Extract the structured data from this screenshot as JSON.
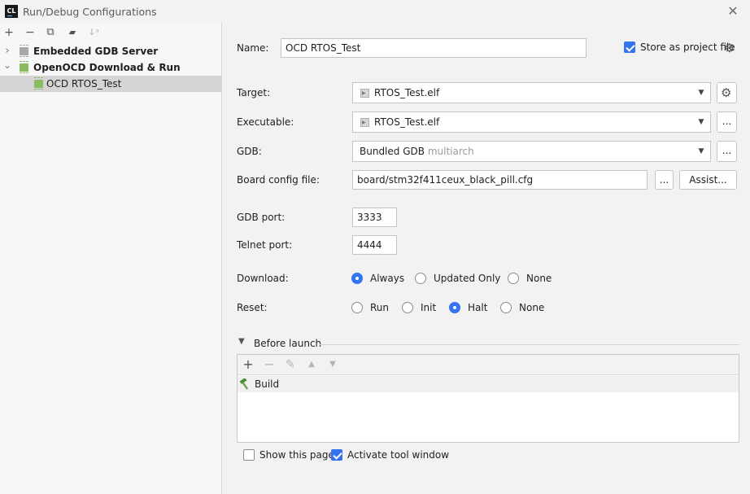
{
  "window": {
    "app_icon_text": "CL",
    "title": "Run/Debug Configurations",
    "close_glyph": "✕"
  },
  "left_toolbar": {
    "add": "+",
    "remove": "−",
    "copy": "⧉",
    "new_folder": "▰",
    "sort": "↓ᵃ"
  },
  "tree": {
    "items": [
      {
        "label": "Embedded GDB Server",
        "expanded": false,
        "arrow": "›"
      },
      {
        "label": "OpenOCD Download & Run",
        "expanded": true,
        "arrow": "⌄"
      },
      {
        "label": "OCD RTOS_Test",
        "selected": true
      }
    ]
  },
  "form": {
    "name_label": "Name:",
    "name_value": "OCD RTOS_Test",
    "store_label": "Store as project file",
    "store_checked": true,
    "target_label": "Target:",
    "target_value": "RTOS_Test.elf",
    "executable_label": "Executable:",
    "executable_value": "RTOS_Test.elf",
    "gdb_label": "GDB:",
    "gdb_value": "Bundled GDB",
    "gdb_value_suffix": "multiarch",
    "board_label": "Board config file:",
    "board_value": "board/stm32f411ceux_black_pill.cfg",
    "ellipsis": "...",
    "assist_label": "Assist...",
    "gdb_port_label": "GDB port:",
    "gdb_port_value": "3333",
    "telnet_port_label": "Telnet port:",
    "telnet_port_value": "4444",
    "download_label": "Download:",
    "download_options": [
      "Always",
      "Updated Only",
      "None"
    ],
    "download_selected": "Always",
    "reset_label": "Reset:",
    "reset_options": [
      "Run",
      "Init",
      "Halt",
      "None"
    ],
    "reset_selected": "Halt"
  },
  "before_launch": {
    "title": "Before launch",
    "toolbar": {
      "add": "+",
      "remove": "−",
      "edit": "✎",
      "up": "▲",
      "down": "▼"
    },
    "tasks": [
      "Build"
    ]
  },
  "footer": {
    "show_page_label": "Show this page",
    "show_page_checked": false,
    "activate_label": "Activate tool window",
    "activate_checked": true
  },
  "colors": {
    "accent": "#3574f0",
    "selection": "#d5d5d5",
    "chip_green": "#8aba63",
    "chip_gray": "#a8a8a8"
  }
}
